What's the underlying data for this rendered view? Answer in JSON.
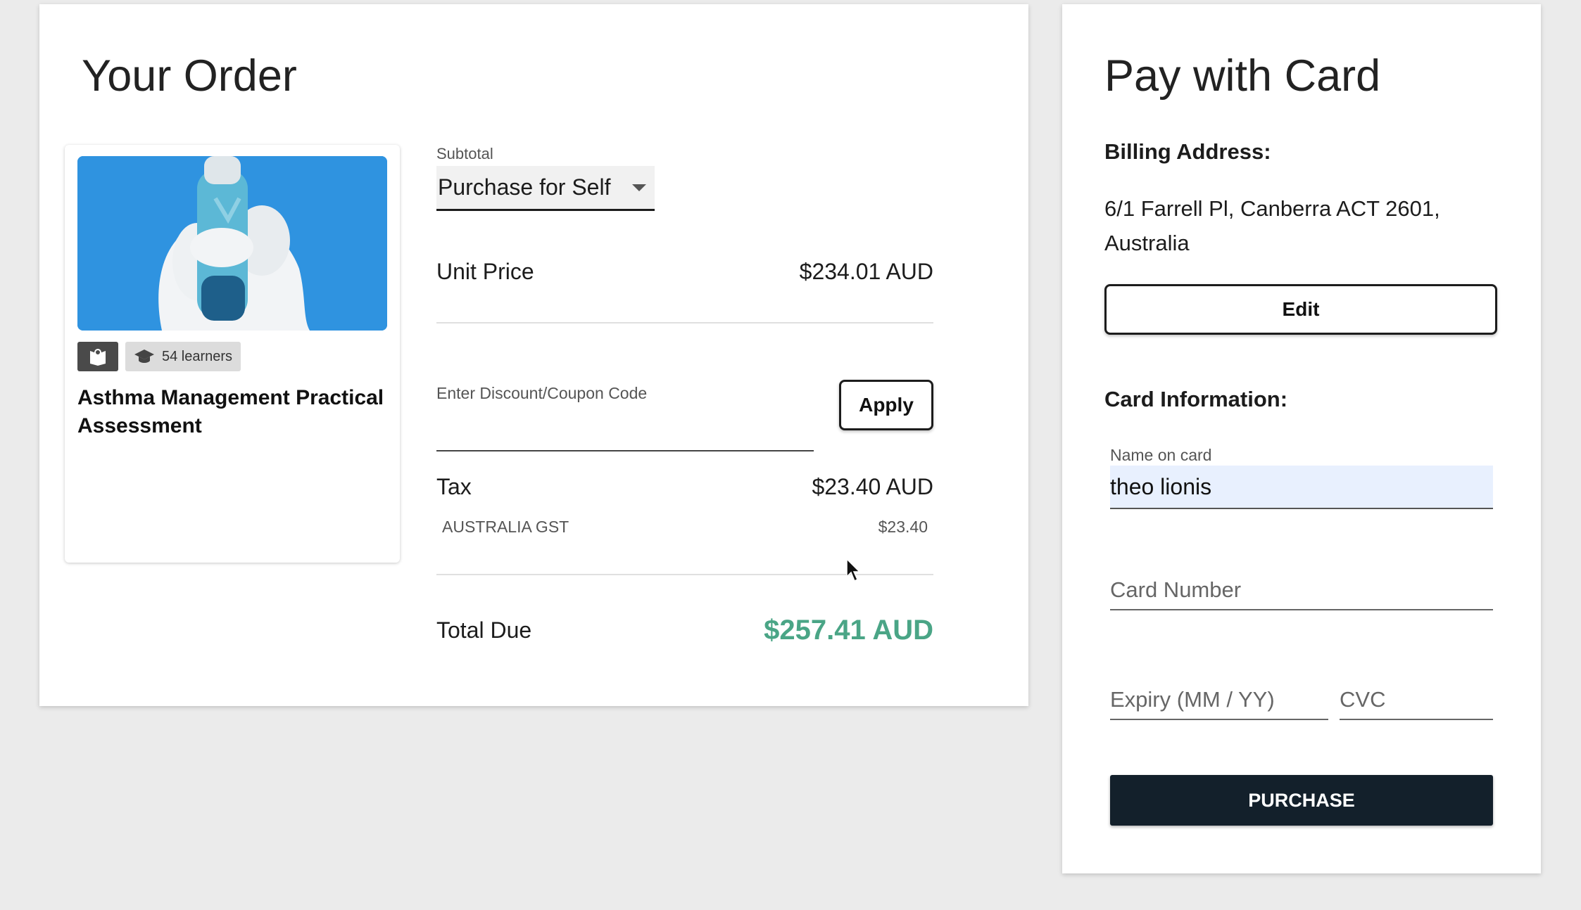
{
  "order": {
    "title": "Your Order",
    "course": {
      "image_icon": "asthma-inhaler-image",
      "learners": "54 learners",
      "title": "Asthma Management Practical Assessment"
    },
    "subtotal_label": "Subtotal",
    "purchase_option": "Purchase for Self",
    "unit_price_label": "Unit Price",
    "unit_price_value": "$234.01 AUD",
    "discount_label": "Enter Discount/Coupon Code",
    "discount_value": "",
    "apply_label": "Apply",
    "tax_label": "Tax",
    "tax_value": "$23.40 AUD",
    "gst_label": "AUSTRALIA GST",
    "gst_value": "$23.40",
    "total_label": "Total Due",
    "total_value": "$257.41 AUD",
    "total_color": "#4aa586"
  },
  "payment": {
    "title": "Pay with Card",
    "billing_heading": "Billing Address:",
    "address": "6/1 Farrell Pl, Canberra ACT 2601, Australia",
    "edit_label": "Edit",
    "card_heading": "Card Information:",
    "name_label": "Name on card",
    "name_value": "theo lionis",
    "card_number_placeholder": "Card Number",
    "expiry_placeholder": "Expiry (MM / YY)",
    "cvc_placeholder": "CVC",
    "purchase_label": "PURCHASE",
    "purchase_color": "#13202b"
  }
}
